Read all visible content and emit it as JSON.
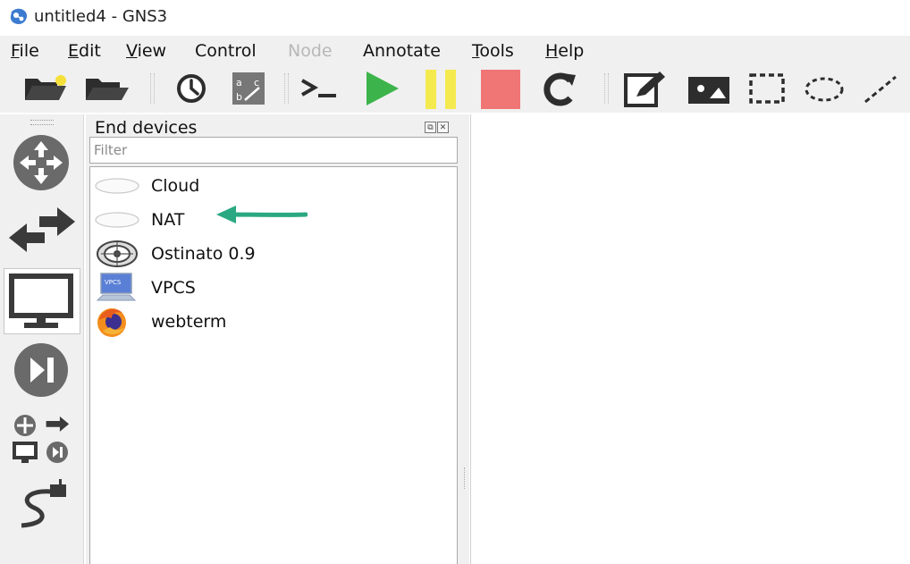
{
  "window": {
    "title": "untitled4 - GNS3"
  },
  "menu": {
    "file": {
      "underline": "F",
      "rest": "ile"
    },
    "edit": {
      "underline": "E",
      "rest": "dit"
    },
    "view": {
      "underline": "V",
      "rest": "iew"
    },
    "control": {
      "label": "Control"
    },
    "node": {
      "label": "Node"
    },
    "annotate": {
      "label": "Annotate"
    },
    "tools": {
      "underline": "T",
      "rest": "ools"
    },
    "help": {
      "underline": "H",
      "rest": "elp"
    }
  },
  "toolbar": {
    "icons": [
      "new-project-icon",
      "open-project-icon",
      "snapshot-icon",
      "show-interface-labels-icon",
      "console-all-icon",
      "start-all-icon",
      "suspend-all-icon",
      "stop-all-icon",
      "reload-all-icon",
      "add-note-icon",
      "insert-picture-icon",
      "draw-rectangle-icon",
      "draw-ellipse-icon",
      "draw-line-icon"
    ],
    "colors": {
      "start": "#3cb44b",
      "suspend": "#f4ea4f",
      "stop": "#f07575",
      "folder": "#2d2d2d"
    }
  },
  "sidebar": {
    "icons": [
      "browse-routers-icon",
      "browse-switches-icon",
      "browse-end-devices-icon",
      "browse-security-devices-icon",
      "browse-all-devices-icon",
      "add-link-icon"
    ],
    "active": "browse-end-devices-icon"
  },
  "dock": {
    "title": "End devices",
    "float_glyph": "⧉",
    "close_glyph": "✕",
    "filter_placeholder": "Filter",
    "devices": [
      {
        "label": "Cloud",
        "icon": "cloud-icon"
      },
      {
        "label": "NAT",
        "icon": "nat-cloud-icon"
      },
      {
        "label": "Ostinato 0.9",
        "icon": "ostinato-icon"
      },
      {
        "label": "VPCS",
        "icon": "vpcs-icon",
        "icon_text": "VPCS"
      },
      {
        "label": "webterm",
        "icon": "firefox-icon"
      }
    ]
  },
  "annotation": {
    "arrow_color": "#2aa882"
  }
}
